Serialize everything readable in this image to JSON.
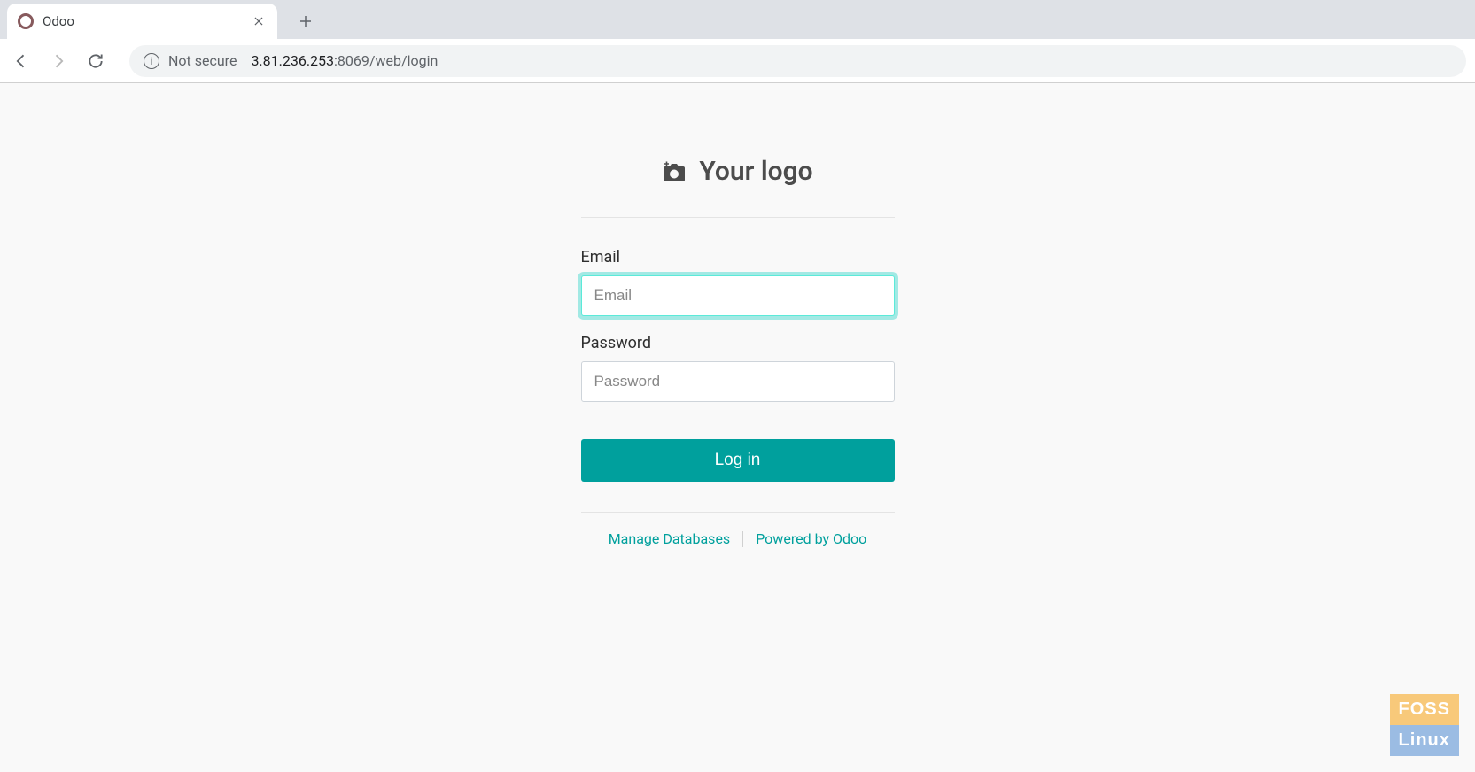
{
  "browser": {
    "tab_title": "Odoo",
    "not_secure_label": "Not secure",
    "url_host": "3.81.236.253",
    "url_port_path": ":8069/web/login"
  },
  "login": {
    "logo_text": "Your logo",
    "email_label": "Email",
    "email_placeholder": "Email",
    "email_value": "",
    "password_label": "Password",
    "password_placeholder": "Password",
    "password_value": "",
    "submit_label": "Log in",
    "footer": {
      "manage_db": "Manage Databases",
      "powered_by": "Powered by Odoo"
    }
  },
  "watermark": {
    "line1": "FOSS",
    "line2": "Linux"
  }
}
